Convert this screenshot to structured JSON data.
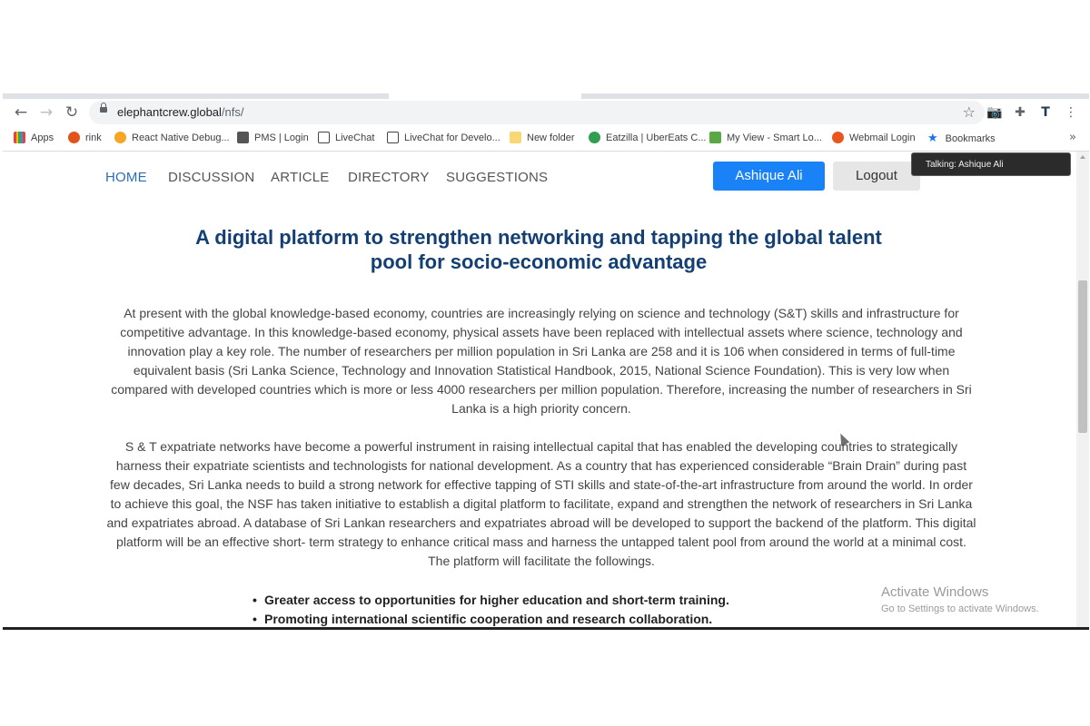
{
  "browser": {
    "url_host": "elephantcrew.global",
    "url_path": "/nfs/",
    "bookmarks": [
      {
        "label": "Apps",
        "color": "#ea4335"
      },
      {
        "label": "rink",
        "color": "#e2531a"
      },
      {
        "label": "React Native Debug...",
        "color": "#f5a623"
      },
      {
        "label": "PMS | Login",
        "color": "#555555"
      },
      {
        "label": "LiveChat",
        "color": "#444444"
      },
      {
        "label": "LiveChat for Develo...",
        "color": "#444444"
      },
      {
        "label": "New folder",
        "color": "#f8d775"
      },
      {
        "label": "Eatzilla | UberEats C...",
        "color": "#2e9e4f"
      },
      {
        "label": "My View - Smart Lo...",
        "color": "#5aa844"
      },
      {
        "label": "Webmail Login",
        "color": "#e8561e"
      },
      {
        "label": "Bookmarks",
        "color": "#1a73e8"
      }
    ]
  },
  "site": {
    "nav": [
      "HOME",
      "DISCUSSION",
      "ARTICLE",
      "DIRECTORY",
      "SUGGESTIONS"
    ],
    "user_button": "Ashique Ali",
    "logout_button": "Logout",
    "accent_color": "#1a82f7"
  },
  "tooltip": "Talking: Ashique Ali",
  "content": {
    "headline_line1": "A digital platform to strengthen networking and tapping the global talent",
    "headline_line2": "pool for socio-economic advantage",
    "paragraph1": "At present with the global knowledge-based economy, countries are increasingly relying on science and technology (S&T) skills and infrastructure for competitive advantage. In this knowledge-based economy, physical assets have been replaced with intellectual assets where science, technology and innovation play a key role. The number of researchers per million population in Sri Lanka are 258 and it is 106 when considered in terms of full-time equivalent basis (Sri Lanka Science, Technology and Innovation Statistical Handbook, 2015, National Science Foundation). This is very low when compared with developed countries which is more or less 4000 researchers per million population. Therefore, increasing the number of researchers in Sri Lanka is a high priority concern.",
    "paragraph2": "S & T expatriate networks have become a powerful instrument in raising intellectual capital that has enabled the developing countries to strategically harness their expatriate scientists and technologists for national development. As a country that has experienced considerable “Brain Drain” during past few decades, Sri Lanka needs to build a strong network for effective tapping of STI skills and state-of-the-art infrastructure from around the world. In order to achieve this goal, the NSF has taken initiative to establish a digital platform to facilitate, expand and strengthen the network of researchers in Sri Lanka and expatriates abroad. A database of Sri Lankan researchers and expatriates abroad will be developed to support the backend of the platform. This digital platform will be an effective short- term strategy to enhance critical mass and harness the untapped talent pool from around the world at a minimal cost. The platform will facilitate the followings.",
    "bullets": [
      "Greater access to opportunities for higher education and short-term training.",
      "Promoting international scientific cooperation and research collaboration."
    ]
  },
  "watermark": {
    "title": "Activate Windows",
    "subtitle": "Go to Settings to activate Windows."
  }
}
